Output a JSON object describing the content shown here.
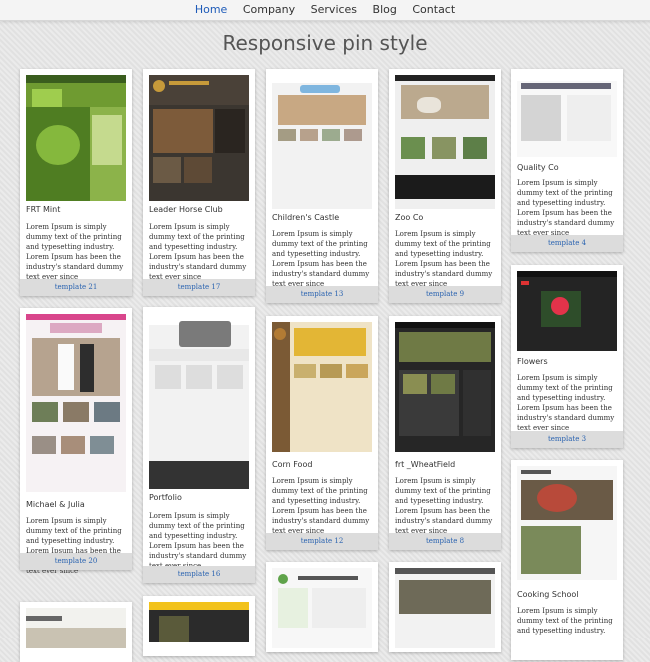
{
  "nav": {
    "items": [
      {
        "label": "Home",
        "active": true
      },
      {
        "label": "Company",
        "active": false
      },
      {
        "label": "Services",
        "active": false
      },
      {
        "label": "Blog",
        "active": false
      },
      {
        "label": "Contact",
        "active": false
      }
    ]
  },
  "page": {
    "title": "Responsive pin style"
  },
  "cards": [
    {
      "title": "FRT Mint",
      "desc": "Lorem Ipsum is simply dummy text of the printing and typesetting industry. Lorem Ipsum has been the industry's standard dummy text ever since",
      "link": "template 21"
    },
    {
      "title": "Leader Horse Club",
      "desc": "Lorem Ipsum is simply dummy text of the printing and typesetting industry. Lorem Ipsum has been the industry's standard dummy text ever since",
      "link": "template 17"
    },
    {
      "title": "Children's Castle",
      "desc": "Lorem Ipsum is simply dummy text of the printing and typesetting industry. Lorem Ipsum has been the industry's standard dummy text ever since",
      "link": "template 13"
    },
    {
      "title": "Zoo Co",
      "desc": "Lorem Ipsum is simply dummy text of the printing and typesetting industry. Lorem Ipsum has been the industry's standard dummy text ever since",
      "link": "template 9"
    },
    {
      "title": "Quality Co",
      "desc": "Lorem Ipsum is simply dummy text of the printing and typesetting industry. Lorem Ipsum has been the industry's standard dummy text ever since",
      "link": "template 4"
    },
    {
      "title": "Michael & Julia",
      "desc": "Lorem Ipsum is simply dummy text of the printing and typesetting industry. Lorem Ipsum has been the industry's standard dummy text ever since",
      "link": "template 20"
    },
    {
      "title": "Portfolio",
      "desc": "Lorem Ipsum is simply dummy text of the printing and typesetting industry. Lorem Ipsum has been the industry's standard dummy text ever since",
      "link": "template 16"
    },
    {
      "title": "Corn Food",
      "desc": "Lorem Ipsum is simply dummy text of the printing and typesetting industry. Lorem Ipsum has been the industry's standard dummy text ever since",
      "link": "template 12"
    },
    {
      "title": "frt _WheatField",
      "desc": "Lorem Ipsum is simply dummy text of the printing and typesetting industry. Lorem Ipsum has been the industry's standard dummy text ever since",
      "link": "template 8"
    },
    {
      "title": "Flowers",
      "desc": "Lorem Ipsum is simply dummy text of the printing and typesetting industry. Lorem Ipsum has been the industry's standard dummy text ever since",
      "link": "template 3"
    },
    {
      "title": "Cooking School",
      "desc": "Lorem Ipsum is simply dummy text of the printing and typesetting industry.",
      "link": ""
    }
  ]
}
